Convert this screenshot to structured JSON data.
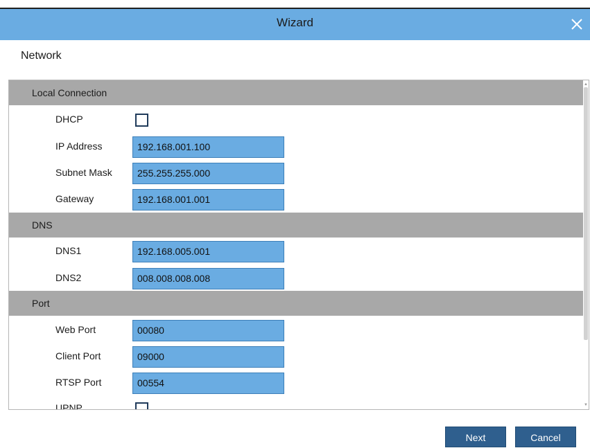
{
  "window": {
    "title": "Wizard",
    "close_icon": "close-icon"
  },
  "page": {
    "heading": "Network"
  },
  "sections": [
    {
      "title": "Local Connection",
      "rows": [
        {
          "label": "DHCP",
          "type": "checkbox",
          "checked": false
        },
        {
          "label": "IP Address",
          "type": "text",
          "value": "192.168.001.100"
        },
        {
          "label": "Subnet Mask",
          "type": "text",
          "value": "255.255.255.000"
        },
        {
          "label": "Gateway",
          "type": "text",
          "value": "192.168.001.001"
        }
      ]
    },
    {
      "title": "DNS",
      "rows": [
        {
          "label": "DNS1",
          "type": "text",
          "value": "192.168.005.001"
        },
        {
          "label": "DNS2",
          "type": "text",
          "value": "008.008.008.008"
        }
      ]
    },
    {
      "title": "Port",
      "rows": [
        {
          "label": "Web Port",
          "type": "text",
          "value": "00080"
        },
        {
          "label": "Client Port",
          "type": "text",
          "value": "09000"
        },
        {
          "label": "RTSP Port",
          "type": "text",
          "value": "00554"
        },
        {
          "label": "UPNP",
          "type": "checkbox",
          "checked": false
        }
      ]
    }
  ],
  "footer": {
    "next_label": "Next",
    "cancel_label": "Cancel"
  },
  "colors": {
    "title_bar": "#6aace2",
    "field": "#6aace2",
    "section_header": "#a8a8a8",
    "button": "#2f5f8e"
  }
}
